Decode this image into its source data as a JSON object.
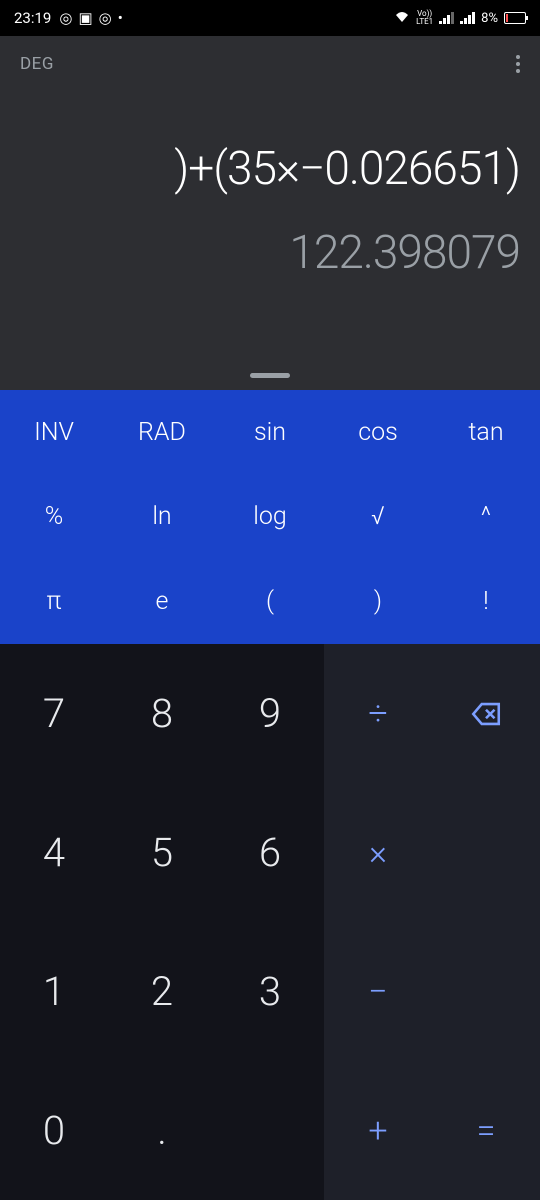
{
  "status": {
    "time": "23:19",
    "battery": "8%",
    "network": "LTE1",
    "volte": "Vo))"
  },
  "header": {
    "mode": "DEG"
  },
  "display": {
    "expression": ")+(35×−0.026651)",
    "result": "122.398079"
  },
  "sci": {
    "r0": [
      "INV",
      "RAD",
      "sin",
      "cos",
      "tan"
    ],
    "r1": [
      "%",
      "ln",
      "log",
      "√",
      "^"
    ],
    "r2": [
      "π",
      "e",
      "(",
      ")",
      "!"
    ]
  },
  "nums": {
    "r0": [
      "7",
      "8",
      "9"
    ],
    "r1": [
      "4",
      "5",
      "6"
    ],
    "r2": [
      "1",
      "2",
      "3"
    ],
    "r3": [
      "0",
      ".",
      ""
    ]
  },
  "ops": {
    "divide": "÷",
    "multiply": "×",
    "minus": "−",
    "plus": "+",
    "equals": "="
  }
}
